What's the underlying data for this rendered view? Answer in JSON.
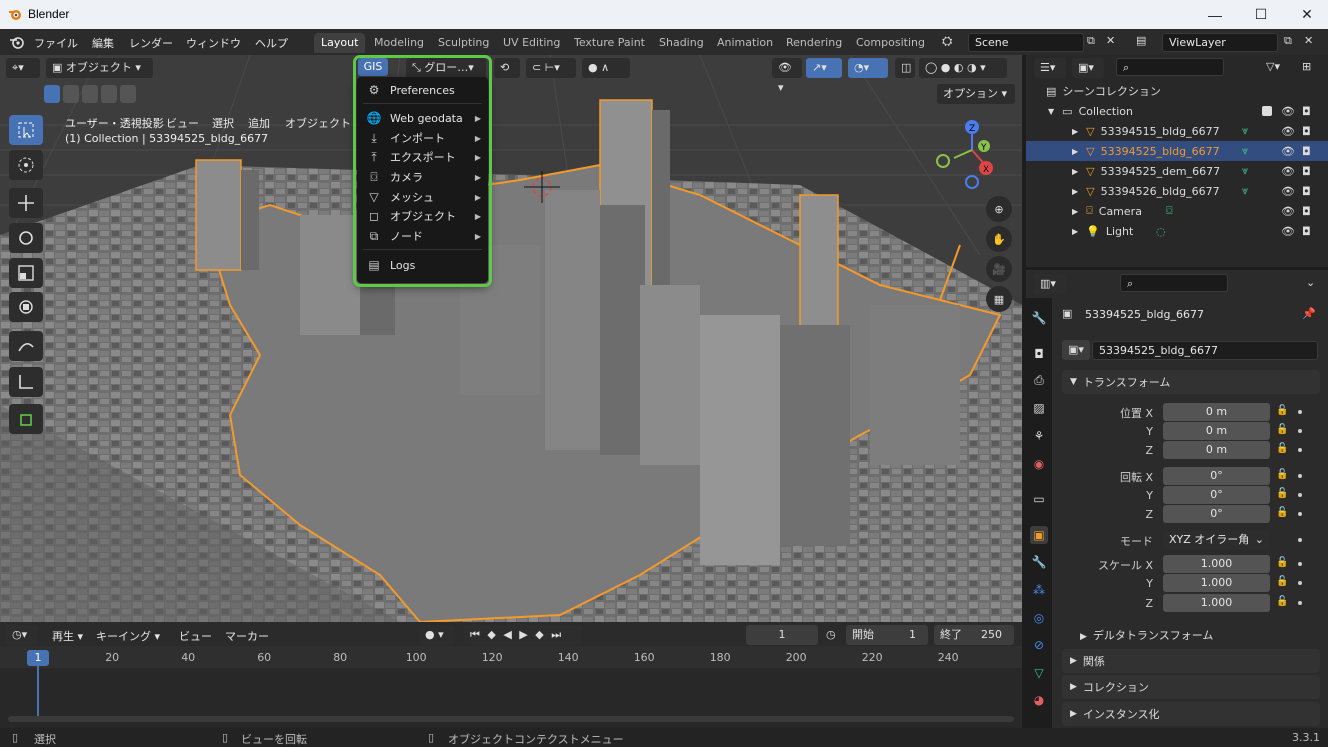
{
  "window": {
    "app_name": "Blender",
    "minimize": "—",
    "maximize": "☐",
    "close": "✕"
  },
  "menubar": {
    "items": [
      "ファイル",
      "編集",
      "レンダー",
      "ウィンドウ",
      "ヘルプ"
    ]
  },
  "workspaces": {
    "tabs": [
      "Layout",
      "Modeling",
      "Sculpting",
      "UV Editing",
      "Texture Paint",
      "Shading",
      "Animation",
      "Rendering",
      "Compositing"
    ],
    "active": "Layout"
  },
  "scene": {
    "name": "Scene",
    "view_layer": "ViewLayer"
  },
  "viewport_header": {
    "mode": "オブジェクト",
    "view": "ビュー",
    "select": "選択",
    "add": "追加",
    "object": "オブジェクト",
    "transform_orientation": "グロー…",
    "options": "オプション"
  },
  "viewport": {
    "view_name": "ユーザー・透視投影",
    "collection_info": "(1) Collection | 53394525_bldg_6677"
  },
  "gis_menu": {
    "button": "GIS",
    "items": [
      {
        "label": "Preferences",
        "icon": "gear-icon",
        "submenu": false
      },
      {
        "label": "Web geodata",
        "icon": "globe-icon",
        "submenu": true
      },
      {
        "label": "インポート",
        "icon": "import-icon",
        "submenu": true
      },
      {
        "label": "エクスポート",
        "icon": "export-icon",
        "submenu": true
      },
      {
        "label": "カメラ",
        "icon": "camera-icon",
        "submenu": true
      },
      {
        "label": "メッシュ",
        "icon": "mesh-icon",
        "submenu": true
      },
      {
        "label": "オブジェクト",
        "icon": "object-icon",
        "submenu": true
      },
      {
        "label": "ノード",
        "icon": "node-icon",
        "submenu": true
      },
      {
        "label": "Logs",
        "icon": "logs-icon",
        "submenu": false
      }
    ]
  },
  "timeline": {
    "playback": "再生",
    "keying": "キーイング",
    "view": "ビュー",
    "marker": "マーカー",
    "current_frame": "1",
    "start_label": "開始",
    "start": "1",
    "end_label": "終了",
    "end": "250",
    "ticks": [
      "1",
      "20",
      "40",
      "60",
      "80",
      "100",
      "120",
      "140",
      "160",
      "180",
      "200",
      "220",
      "240"
    ]
  },
  "statusbar": {
    "left": "選択",
    "middle": "ビューを回転",
    "right": "オブジェクトコンテクストメニュー",
    "version": "3.3.1"
  },
  "outliner": {
    "root": "シーンコレクション",
    "collection": "Collection",
    "items": [
      {
        "name": "53394515_bldg_6677",
        "selected": false
      },
      {
        "name": "53394525_bldg_6677",
        "selected": true
      },
      {
        "name": "53394525_dem_6677",
        "selected": false
      },
      {
        "name": "53394526_bldg_6677",
        "selected": false
      },
      {
        "name": "Camera",
        "selected": false
      },
      {
        "name": "Light",
        "selected": false
      }
    ]
  },
  "properties": {
    "object_name": "53394525_bldg_6677",
    "data_name": "53394525_bldg_6677",
    "transform_title": "トランスフォーム",
    "location_label": "位置 X",
    "y_label": "Y",
    "z_label": "Z",
    "location": [
      "0 m",
      "0 m",
      "0 m"
    ],
    "rotation_label": "回転 X",
    "rotation": [
      "0°",
      "0°",
      "0°"
    ],
    "mode_label": "モード",
    "mode": "XYZ オイラー角",
    "scale_label": "スケール X",
    "scale": [
      "1.000",
      "1.000",
      "1.000"
    ],
    "delta": "デルタトランスフォーム",
    "relations": "関係",
    "collections": "コレクション",
    "instancing": "インスタンス化"
  },
  "colors": {
    "accent": "#4772b3",
    "selection_outline": "#f39a2b",
    "highlight_box": "#5ec947"
  }
}
